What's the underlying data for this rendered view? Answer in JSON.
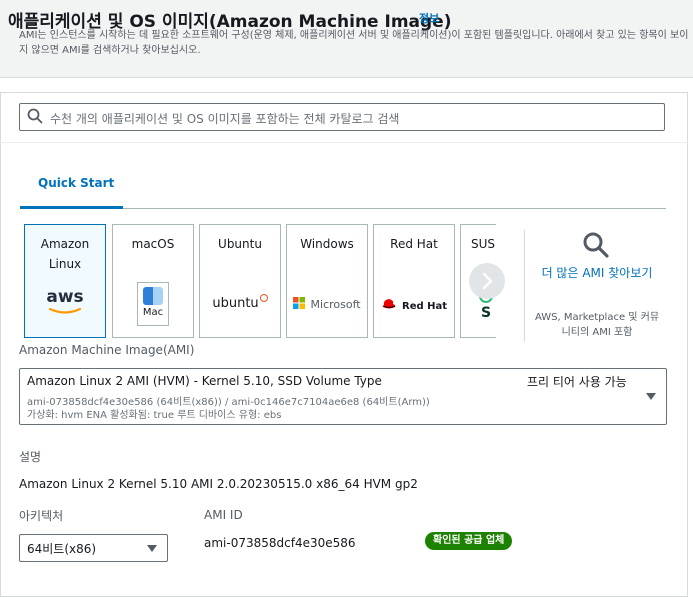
{
  "header": {
    "title": "애플리케이션 및 OS 이미지(Amazon Machine Image)",
    "info_link": "정보",
    "description": "AMI는 인스턴스를 시작하는 데 필요한 소프트웨어 구성(운영 체제, 애플리케이션 서버 및 애플리케이션)이 포함된 템플릿입니다. 아래에서 찾고 있는 항목이 보이지 않으면 AMI를 검색하거나 찾아보십시오."
  },
  "search": {
    "placeholder": "수천 개의 애플리케이션 및 OS 이미지를 포함하는 전체 카탈로그 검색",
    "icon": "search-icon"
  },
  "tabs": [
    {
      "label": "Quick Start",
      "active": true
    }
  ],
  "os_tiles": [
    {
      "label": "Amazon Linux",
      "logo_text": "aws",
      "selected": true
    },
    {
      "label": "macOS",
      "logo_text": "Mac",
      "selected": false
    },
    {
      "label": "Ubuntu",
      "logo_text": "ubuntu",
      "selected": false
    },
    {
      "label": "Windows",
      "logo_text": "Microsoft",
      "selected": false
    },
    {
      "label": "Red Hat",
      "logo_text": "Red Hat",
      "selected": false
    },
    {
      "label": "SUSI",
      "logo_text": "S",
      "selected": false
    }
  ],
  "carousel": {
    "next_icon": "chevron-right-icon"
  },
  "browse_more": {
    "icon": "search-icon",
    "link": "더 많은 AMI 찾아보기",
    "description": "AWS, Marketplace 및 커뮤니티의 AMI 포함"
  },
  "ami": {
    "label": "Amazon Machine Image(AMI)",
    "name": "Amazon Linux 2 AMI (HVM) - Kernel 5.10, SSD Volume Type",
    "free_tier": "프리 티어 사용 가능",
    "ids": "ami-073858dcf4e30e586 (64비트(x86)) / ami-0c146e7c7104ae6e8 (64비트(Arm))",
    "attributes": "가상화: hvm    ENA 활성화됨: true    루트 디바이스 유형: ebs"
  },
  "description_section": {
    "label": "설명",
    "value": "Amazon Linux 2 Kernel 5.10 AMI 2.0.20230515.0 x86_64 HVM gp2"
  },
  "architecture": {
    "label": "아키텍처",
    "value": "64비트(x86)"
  },
  "ami_id": {
    "label": "AMI ID",
    "value": "ami-073858dcf4e30e586",
    "badge": "확인된 공급 업체"
  },
  "colors": {
    "link": "#0073bb",
    "badge": "#1d8102",
    "aws_orange": "#ff9900",
    "ubuntu_orange": "#e95420",
    "redhat_red": "#ee0000"
  }
}
